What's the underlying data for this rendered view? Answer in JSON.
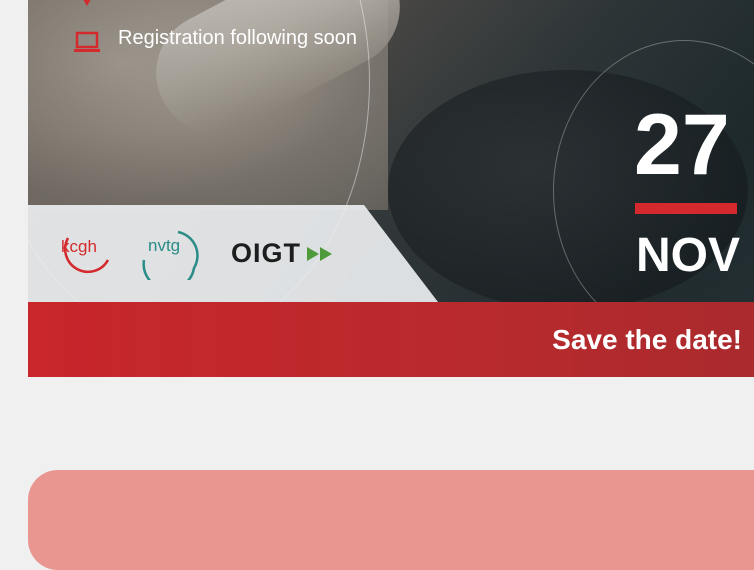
{
  "event": {
    "registration_text": "Registration following soon",
    "day": "27",
    "month": "NOV",
    "save_the_date": "Save the date!"
  },
  "logos": {
    "kcgh": "kcgh",
    "nvtg": "nvtg",
    "oigt": "OIGT"
  },
  "colors": {
    "accent_red": "#d42a2e",
    "band_red": "#c8262b",
    "card_pink": "#e99590",
    "page_bg": "#f0f0f0"
  }
}
